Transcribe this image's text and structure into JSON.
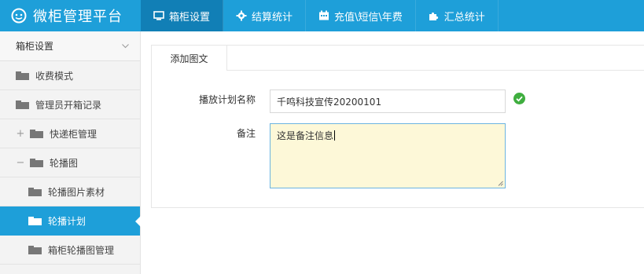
{
  "app": {
    "title": "微柜管理平台"
  },
  "nav": [
    {
      "label": "箱柜设置",
      "icon": "monitor-icon"
    },
    {
      "label": "结算统计",
      "icon": "gear-icon"
    },
    {
      "label": "充值\\短信\\年费",
      "icon": "calendar-icon"
    },
    {
      "label": "汇总统计",
      "icon": "puzzle-icon"
    }
  ],
  "sidebar": {
    "header": "箱柜设置",
    "items": [
      {
        "label": "收费模式"
      },
      {
        "label": "管理员开箱记录"
      },
      {
        "label": "快递柜管理",
        "toggle": "+"
      },
      {
        "label": "轮播图",
        "toggle": "−"
      },
      {
        "label": "轮播图片素材"
      },
      {
        "label": "轮播计划"
      },
      {
        "label": "箱柜轮播图管理"
      }
    ]
  },
  "tab": {
    "label": "添加图文"
  },
  "form": {
    "plan_name_label": "播放计划名称",
    "plan_name_value": "千鸣科技宣传20200101",
    "note_label": "备注",
    "note_value": "这是备注信息"
  },
  "colors": {
    "primary": "#1e9fd9",
    "active_nav": "#117fb6",
    "valid": "#3fae3f",
    "textarea_bg": "#fdf8d8"
  }
}
